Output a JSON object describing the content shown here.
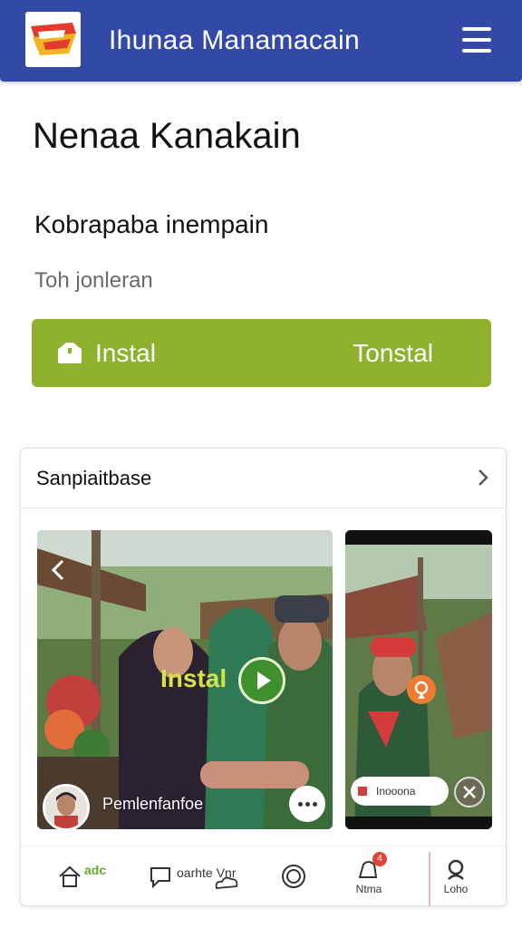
{
  "header": {
    "app_title": "Ihunaa Manamacain"
  },
  "page": {
    "title": "Nenaa Kanakain",
    "subtitle": "Kobrapaba inempain",
    "caption": "Toh jonleran"
  },
  "install": {
    "left_label": "Instal",
    "right_label": "Tonstal"
  },
  "card": {
    "title": "Sanpiaitbase",
    "video": {
      "overlay_label": "Instal",
      "author": "Pemlenfanfoe"
    },
    "side_video": {
      "chip_text": "Inooona"
    }
  },
  "nav": {
    "home_label": "adc",
    "chat_label": "oarhte",
    "chat_label2": "Vnr",
    "notify_label": "Ntma",
    "notify_badge": "4",
    "profile_label": "Loho"
  },
  "colors": {
    "header": "#3249a6",
    "install": "#8fb22e",
    "play": "#3f8f2e"
  }
}
